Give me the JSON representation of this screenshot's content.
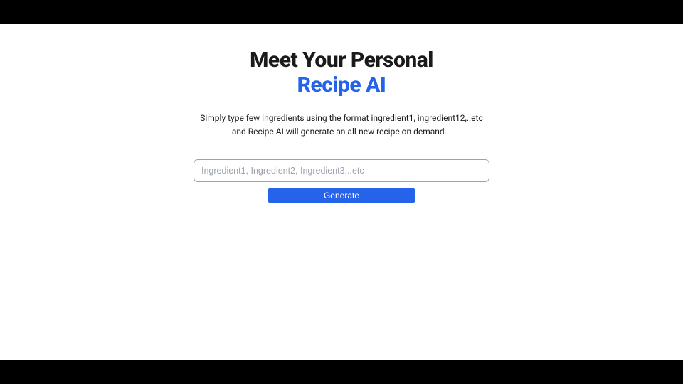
{
  "hero": {
    "title_line1": "Meet Your Personal",
    "title_line2": "Recipe AI",
    "subtitle": "Simply type few ingredients using the format ingredient1, ingredient12,..etc and Recipe AI will generate an all-new recipe on demand..."
  },
  "form": {
    "ingredients_placeholder": "Ingredient1, Ingredient2, Ingredient3,..etc",
    "ingredients_value": "",
    "generate_label": "Generate"
  },
  "colors": {
    "accent": "#2563eb",
    "text": "#1a1a1a"
  }
}
